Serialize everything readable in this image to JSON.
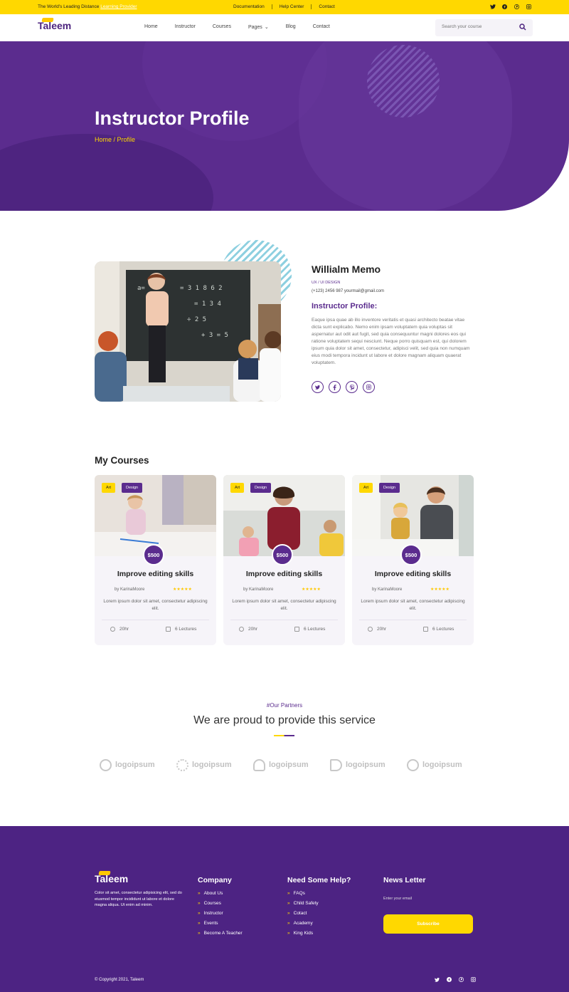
{
  "topbar": {
    "tagline": "The World's Leading Distance",
    "tagline_link": "Learning Provider",
    "links": [
      "Documentation",
      "Help Center",
      "Contact"
    ]
  },
  "brand": {
    "name": "Taleem",
    "accent": "#ffd800",
    "primary": "#5b2c8e"
  },
  "nav": {
    "items": [
      "Home",
      "Instructor",
      "Courses",
      "Pages",
      "Blog",
      "Contact"
    ],
    "search_placeholder": "Search your course"
  },
  "hero": {
    "title": "Instructor Profile",
    "breadcrumb": "Home / Profile"
  },
  "instructor": {
    "name": "Willialm Memo",
    "role": "UX / UI DESIGN",
    "contact": "(+123) 2456 987 yourmail@gmail.com",
    "subtitle": "Instructor Profile:",
    "description": "Eaque ipsa quae ab illo inventore veritatis et quasi architecto beatae vitae dicta sunt explicabo. Nemo enim ipsam voluptatem quia voluptas sit aspernatur aut odit aut fugit, sed quia consequuntur magni dolores eos qui ratione voluptatem sequi nesciunt. Neque porro quisquam est, qui dolorem ipsum quia dolor sit amet, consectetur, adipisci velit, sed quia non numquam eius modi tempora incidunt ut labore et dolore magnam aliquam quaerat voluptatem.",
    "socials": [
      "twitter-icon",
      "facebook-icon",
      "pinterest-icon",
      "instagram-icon"
    ]
  },
  "courses": {
    "heading": "My Courses",
    "items": [
      {
        "badge1": "Art",
        "badge2": "Design",
        "price": "$500",
        "title": "Improve editing skills",
        "author": "by KarinaMoore",
        "stars": "★★★★★",
        "desc": "Lorem ipsum dolor sit amet, consectetur adipiscing elit.",
        "hours": "20hr",
        "lectures": "6 Lectures"
      },
      {
        "badge1": "Art",
        "badge2": "Design",
        "price": "$500",
        "title": "Improve editing skills",
        "author": "by KarinaMoore",
        "stars": "★★★★★",
        "desc": "Lorem ipsum dolor sit amet, consectetur adipiscing elit.",
        "hours": "20hr",
        "lectures": "6 Lectures"
      },
      {
        "badge1": "Art",
        "badge2": "Design",
        "price": "$500",
        "title": "Improve editing skills",
        "author": "by KarinaMoore",
        "stars": "★★★★★",
        "desc": "Lorem ipsum dolor sit amet, consectetur adipiscing elit.",
        "hours": "20hr",
        "lectures": "6 Lectures"
      }
    ]
  },
  "partners": {
    "tag": "#Our Partners",
    "title": "We are proud to provide this service",
    "logos": [
      "logoipsum",
      "logoipsum",
      "logoipsum",
      "logoipsum",
      "logoipsum"
    ]
  },
  "footer": {
    "brand": "Taleem",
    "desc": "Color sit amet, consectetur adipisicing elit, sed do eiusmod tempor incididunt ut labore et dolore magna aliqua. Ut enim ad minim.",
    "company": {
      "heading": "Company",
      "items": [
        "About Us",
        "Courses",
        "Instructor",
        "Events",
        "Become A Teacher"
      ]
    },
    "help": {
      "heading": "Need Some Help?",
      "items": [
        "FAQs",
        "Child Safety",
        "Cotact",
        "Academy",
        "King Kids"
      ]
    },
    "newsletter": {
      "heading": "News Letter",
      "placeholder": "Enter your email",
      "button": "Subscribe"
    },
    "copyright": "© Copyright 2021, Taleem"
  }
}
